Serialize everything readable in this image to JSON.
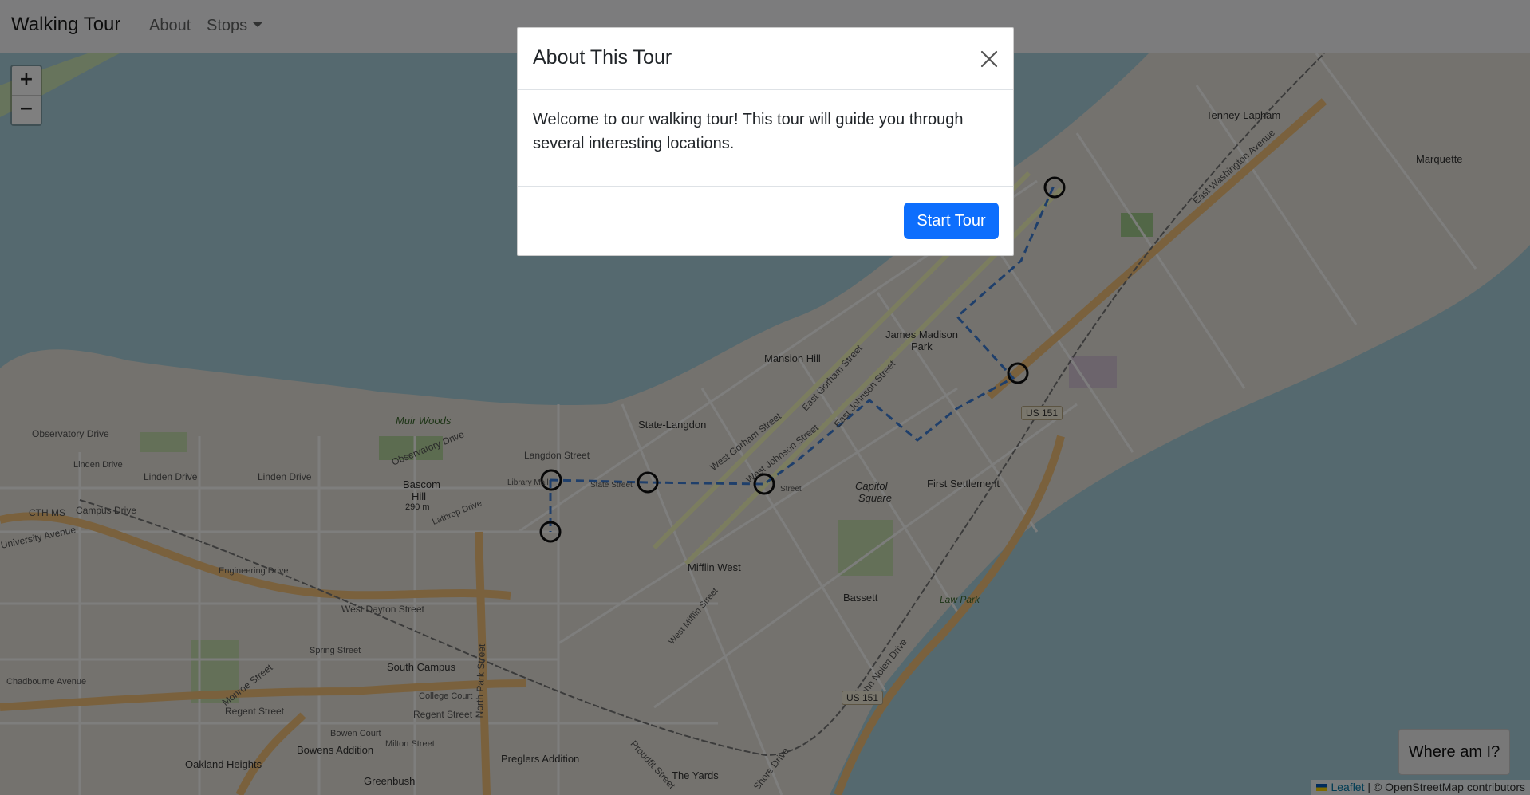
{
  "navbar": {
    "brand": "Walking Tour",
    "about": "About",
    "stops": "Stops"
  },
  "map": {
    "zoom_in": "+",
    "zoom_out": "−",
    "where_button": "Where am I?",
    "attribution": {
      "leaflet": "Leaflet",
      "separator": " | © ",
      "osm": "OpenStreetMap contributors"
    },
    "stop_count": 6,
    "route_color": "#3f7fd6",
    "places": {
      "tenney": "Tenney-Lapham",
      "marquette": "Marquette",
      "james_madison": "James Madison",
      "park": "Park",
      "mansion_hill": "Mansion Hill",
      "state_langdon": "State-Langdon",
      "first_settlement": "First Settlement",
      "capitol": "Capitol",
      "square": "Square",
      "mifflin_west": "Mifflin West",
      "bassett": "Bassett",
      "bascom": "Bascom",
      "hill": "Hill",
      "hill_m": "290 m",
      "south_campus": "South Campus",
      "oakland": "Oakland Heights",
      "bowens": "Bowens Addition",
      "greenbush": "Greenbush",
      "preglers": "Preglers Addition",
      "yards": "The Yards",
      "muir": "Muir Woods",
      "low_park": "Law Park"
    },
    "streets": {
      "observatory": "Observatory Drive",
      "observatory2": "Observatory Drive",
      "linden": "Linden Drive",
      "linden2": "Linden Drive",
      "linden3": "Linden Drive",
      "campus": "Campus Drive",
      "cth": "CTH MS",
      "university": "University Avenue",
      "engineering": "Engineering Drive",
      "dayton": "West Dayton Street",
      "regent": "Regent Street",
      "regent2": "Regent Street",
      "langdon": "Langdon Street",
      "library": "Library Mall",
      "state": "State Street",
      "gorham": "West Gorham Street",
      "johnson": "West Johnson Street",
      "e_gorham": "East Gorham Street",
      "e_johnson": "East Johnson Street",
      "e_washington": "East Washington Avenue",
      "spring": "Spring Street",
      "college": "College Court",
      "milton": "Milton Street",
      "bowen_ct": "Bowen Court",
      "chadbourne": "Chadbourne Avenue",
      "monroe": "Monroe Street",
      "north_park": "North Park Street",
      "john_nolen": "John Nolen Drive",
      "proudfit": "Proudfit Street",
      "shore": "Shore Drive",
      "lathrop": "Lathrop Drive",
      "mifflin": "West Mifflin Street",
      "street": "Street"
    },
    "shields": {
      "us151_a": "US 151",
      "us151_b": "US 151"
    }
  },
  "modal": {
    "title": "About This Tour",
    "body": "Welcome to our walking tour! This tour will guide you through several interesting locations.",
    "start_button": "Start Tour"
  }
}
